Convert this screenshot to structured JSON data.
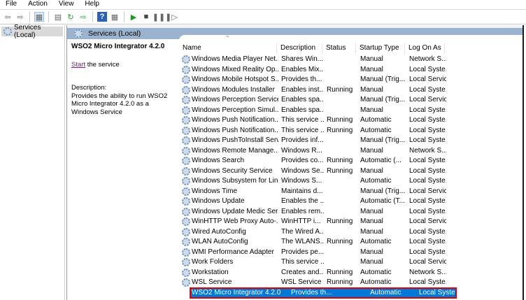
{
  "menu": [
    "File",
    "Action",
    "View",
    "Help"
  ],
  "tree": {
    "root": "Services (Local)"
  },
  "band": {
    "title": "Services (Local)"
  },
  "detail": {
    "title": "WSO2 Micro Integrator 4.2.0",
    "start_link": "Start",
    "start_rest": " the service",
    "desc_label": "Description:",
    "desc": "Provides the ability to run WSO2 Micro Integrator 4.2.0 as a Windows Service"
  },
  "columns": [
    "Name",
    "Description",
    "Status",
    "Startup Type",
    "Log On As"
  ],
  "rows": [
    [
      "Windows Media Player Net...",
      "Shares Win...",
      "",
      "Manual",
      "Network S..."
    ],
    [
      "Windows Mixed Reality Op...",
      "Enables Mix...",
      "",
      "Manual",
      "Local Syste..."
    ],
    [
      "Windows Mobile Hotspot S...",
      "Provides th...",
      "",
      "Manual (Trig...",
      "Local Service"
    ],
    [
      "Windows Modules Installer",
      "Enables inst...",
      "Running",
      "Manual",
      "Local Syste..."
    ],
    [
      "Windows Perception Service",
      "Enables spa...",
      "",
      "Manual (Trig...",
      "Local Service"
    ],
    [
      "Windows Perception Simul...",
      "Enables spa...",
      "",
      "Manual",
      "Local Syste..."
    ],
    [
      "Windows Push Notification...",
      "This service ...",
      "Running",
      "Automatic",
      "Local Syste..."
    ],
    [
      "Windows Push Notification...",
      "This service ...",
      "Running",
      "Automatic",
      "Local Syste..."
    ],
    [
      "Windows PushToInstall Serv...",
      "Provides inf...",
      "",
      "Manual (Trig...",
      "Local Syste..."
    ],
    [
      "Windows Remote Manage...",
      "Windows R...",
      "",
      "Manual",
      "Network S..."
    ],
    [
      "Windows Search",
      "Provides co...",
      "Running",
      "Automatic (...",
      "Local Syste..."
    ],
    [
      "Windows Security Service",
      "Windows Se...",
      "Running",
      "Manual",
      "Local Syste..."
    ],
    [
      "Windows Subsystem for Lin...",
      "Windows S...",
      "",
      "Automatic",
      "Local Syste..."
    ],
    [
      "Windows Time",
      "Maintains d...",
      "",
      "Manual (Trig...",
      "Local Service"
    ],
    [
      "Windows Update",
      "Enables the ...",
      "",
      "Automatic (T...",
      "Local Syste..."
    ],
    [
      "Windows Update Medic Ser...",
      "Enables rem...",
      "",
      "Manual",
      "Local Syste..."
    ],
    [
      "WinHTTP Web Proxy Auto-...",
      "WinHTTP i...",
      "Running",
      "Manual",
      "Local Service"
    ],
    [
      "Wired AutoConfig",
      "The Wired A...",
      "",
      "Manual",
      "Local Syste..."
    ],
    [
      "WLAN AutoConfig",
      "The WLANS...",
      "Running",
      "Automatic",
      "Local Syste..."
    ],
    [
      "WMI Performance Adapter",
      "Provides pe...",
      "",
      "Manual",
      "Local Syste..."
    ],
    [
      "Work Folders",
      "This service ...",
      "",
      "Manual",
      "Local Service"
    ],
    [
      "Workstation",
      "Creates and...",
      "Running",
      "Automatic",
      "Network S..."
    ],
    [
      "WSL Service",
      "WSL Service",
      "Running",
      "Automatic",
      "Local Syste..."
    ],
    [
      "WSO2 Micro Integrator 4.2.0",
      "Provides th...",
      "",
      "Automatic",
      "Local Syste..."
    ]
  ],
  "selected_index": 23
}
